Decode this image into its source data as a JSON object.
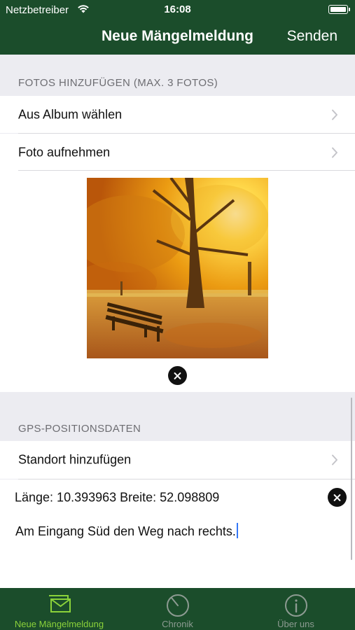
{
  "status_bar": {
    "carrier": "Netzbetreiber",
    "time": "16:08"
  },
  "nav": {
    "title": "Neue Mängelmeldung",
    "action": "Senden"
  },
  "photos": {
    "header": "FOTOS HINZUFÜGEN (MAX. 3 FOTOS)",
    "items": [
      {
        "label": "Aus Album wählen"
      },
      {
        "label": "Foto aufnehmen"
      }
    ]
  },
  "gps": {
    "header": "GPS-POSITIONSDATEN",
    "add_location": "Standort hinzufügen",
    "coordinates": "Länge: 10.393963 Breite: 52.098809"
  },
  "note": {
    "text": "Am Eingang Süd den Weg nach rechts."
  },
  "tabs": [
    {
      "label": "Neue Mängelmeldung",
      "icon": "envelope-icon",
      "active": true
    },
    {
      "label": "Chronik",
      "icon": "clock-icon",
      "active": false
    },
    {
      "label": "Über uns",
      "icon": "info-icon",
      "active": false
    }
  ],
  "colors": {
    "brand": "#1b4d2b",
    "tab_active": "#8bd23a",
    "tab_inactive": "#8d9b92",
    "background": "#ececf1"
  }
}
